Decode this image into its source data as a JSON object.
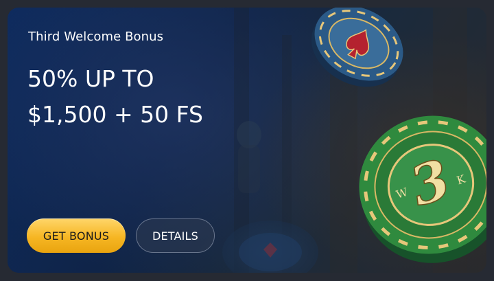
{
  "promo": {
    "subtitle": "Third Welcome Bonus",
    "headline_line1": "50% UP TO",
    "headline_line2": "$1,500 + 50 FS"
  },
  "buttons": {
    "get_bonus": "GET BONUS",
    "details": "DETAILS"
  },
  "chip_big": {
    "numeral": "3",
    "letter_left": "W",
    "letter_right": "K"
  },
  "colors": {
    "primary_button": "#f6b623",
    "card_bg": "#0f2448",
    "chip_green": "#2f8a3e",
    "chip_blue": "#2f5d8c",
    "chip_gold": "#e7c77a"
  }
}
